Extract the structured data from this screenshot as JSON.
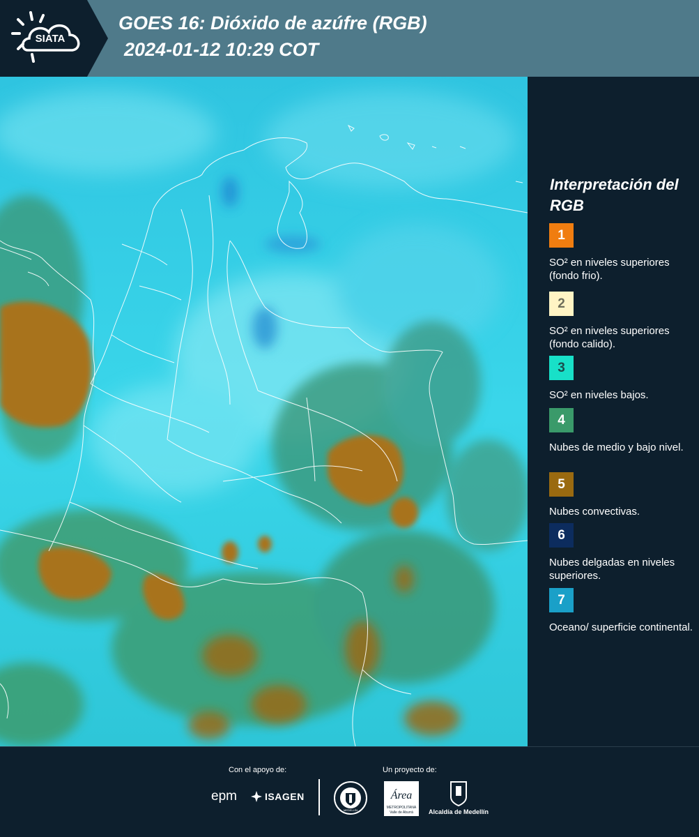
{
  "header": {
    "logo_text": "SIATA",
    "title_line1": "GOES 16: Dióxido de azúfre (RGB)",
    "title_line2": "2024-01-12 10:29 COT"
  },
  "legend": {
    "title": "Interpretación del RGB",
    "items": [
      {
        "number": "1",
        "color": "#f07d10",
        "label": "SO² en niveles superiores (fondo frio)."
      },
      {
        "number": "2",
        "color": "#fff4c4",
        "label": "SO² en niveles superiores (fondo calido)."
      },
      {
        "number": "3",
        "color": "#18e0c8",
        "label": "SO² en niveles bajos."
      },
      {
        "number": "4",
        "color": "#3a9a6a",
        "label": "Nubes de medio y bajo nivel."
      },
      {
        "number": "5",
        "color": "#9a6a10",
        "label": "Nubes convectivas."
      },
      {
        "number": "6",
        "color": "#0c2c5e",
        "label": "Nubes delgadas en niveles superiores."
      },
      {
        "number": "7",
        "color": "#1aa0c8",
        "label": "Oceano/ superficie continental."
      }
    ]
  },
  "footer": {
    "support_label": "Con el apoyo de:",
    "project_label": "Un proyecto de:",
    "sponsors": [
      "epm",
      "ISAGEN",
      "Área Metropolitana Valle de Aburrá",
      "Alcaldía de Medellín"
    ],
    "area_subtitle": "METROPOLITANA",
    "area_subtitle2": "Valle de Aburrá",
    "seal_text": "MEDELLÍN"
  },
  "colors": {
    "header_bg": "#4f7a8a",
    "panel_bg": "#0d1f2d",
    "map_cyan": "#29cde6",
    "convective_brown": "#a8731a",
    "mid_cloud_green": "#3a9a6a"
  }
}
